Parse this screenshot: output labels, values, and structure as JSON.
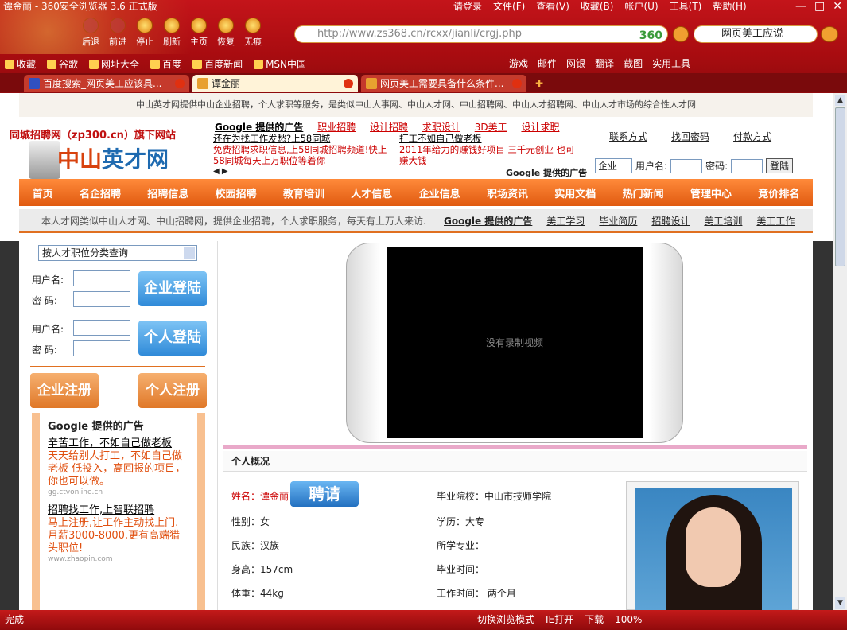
{
  "window": {
    "title": "谭金丽 - 360安全浏览器 3.6 正式版",
    "menu": [
      "请登录",
      "文件(F)",
      "查看(V)",
      "收藏(B)",
      "帐户(U)",
      "工具(T)",
      "帮助(H)"
    ],
    "controls": [
      "—",
      "□",
      "✕"
    ]
  },
  "toolbar": {
    "buttons": [
      {
        "label": "后退",
        "icon": "back-icon"
      },
      {
        "label": "前进",
        "icon": "forward-icon"
      },
      {
        "label": "停止",
        "icon": "stop-icon"
      },
      {
        "label": "刷新",
        "icon": "refresh-icon"
      },
      {
        "label": "主页",
        "icon": "home-icon"
      },
      {
        "label": "恢复",
        "icon": "restore-icon"
      },
      {
        "label": "无痕",
        "icon": "incognito-icon"
      }
    ],
    "address": "http://www.zs368.cn/rcxx/jianli/crgj.php",
    "address_badge": "360",
    "search_value": "网页美工应说"
  },
  "favorites": {
    "items": [
      "收藏",
      "谷歌",
      "网址大全",
      "百度",
      "百度新闻",
      "MSN中国"
    ],
    "right": [
      "游戏",
      "邮件",
      "网银",
      "翻译",
      "截图",
      "实用工具"
    ]
  },
  "tabs": [
    {
      "label": "百度搜索_网页美工应该具...",
      "active": false
    },
    {
      "label": "谭金丽",
      "active": true
    },
    {
      "label": "网页美工需要具备什么条件...",
      "active": false
    }
  ],
  "site": {
    "top_note": "中山英才网提供中山企业招聘，个人求职等服务，是类似中山人事网、中山人才网、中山招聘网、中山人才招聘网、中山人才市场的综合性人才网",
    "logo_small": "同城招聘网（zp300.cn）旗下网站",
    "logo_side": "孙中山",
    "logo_main_a": "中山",
    "logo_main_b": "英才网",
    "ad_header": [
      "Google 提供的广告",
      "职业招聘",
      "设计招聘",
      "求职设计",
      "3D美工",
      "设计求职"
    ],
    "ad1_title": "还在为找工作发愁?上58同城",
    "ad1_desc": "免费招聘求职信息,上58同城招聘频道!快上58同城每天上万职位等着你",
    "ad2_title": "打工不如自己做老板",
    "ad2_desc": "2011年给力的赚钱好项目 三千元创业 也可赚大钱",
    "ad_footer": "Google 提供的广告",
    "top_links": [
      "联系方式",
      "找回密码",
      "付款方式"
    ],
    "login": {
      "type": "企业",
      "user_label": "用户名:",
      "pass_label": "密码:",
      "button": "登陆"
    },
    "nav": [
      "首页",
      "名企招聘",
      "招聘信息",
      "校园招聘",
      "教育培训",
      "人才信息",
      "企业信息",
      "职场资讯",
      "实用文档",
      "热门新闻",
      "管理中心",
      "竞价排名"
    ],
    "sub_desc": "本人才网类似中山人才网、中山招聘网，提供企业招聘，个人求职服务，每天有上万人来访.",
    "sub_links": [
      "Google 提供的广告",
      "美工学习",
      "毕业简历",
      "招聘设计",
      "美工培训",
      "美工工作"
    ]
  },
  "sidebar": {
    "select": "按人才职位分类查询",
    "user_label": "用户名:",
    "pass_label": "密  码:",
    "company_login": "企业登陆",
    "personal_login": "个人登陆",
    "company_register": "企业注册",
    "personal_register": "个人注册",
    "ad_header": "Google 提供的广告",
    "ads": [
      {
        "title": "辛苦工作，不如自己做老板",
        "desc": "天天给别人打工，不如自己做老板 低投入，高回报的项目，你也可以做。",
        "url": "gg.ctvonline.cn"
      },
      {
        "title": "招聘找工作,上智联招聘",
        "desc": "马上注册,让工作主动找上门. 月薪3000-8000,更有高端猎头职位!",
        "url": "www.zhaopin.com"
      }
    ]
  },
  "profile": {
    "video_text": "没有录制视频",
    "section_title": "个人概况",
    "name_label": "姓名：",
    "name": "谭金丽",
    "hire_button": "聘请",
    "left_fields": [
      "性别：女",
      "民族：汉族",
      "身高：157cm",
      "体重：44kg"
    ],
    "right_fields": [
      "毕业院校：中山市技师学院",
      "学历：大专",
      "所学专业：",
      "毕业时间：",
      "工作时间：  两个月"
    ]
  },
  "status": {
    "left": "完成",
    "right": [
      "切换浏览模式",
      "IE打开",
      "下载",
      "100%"
    ]
  }
}
